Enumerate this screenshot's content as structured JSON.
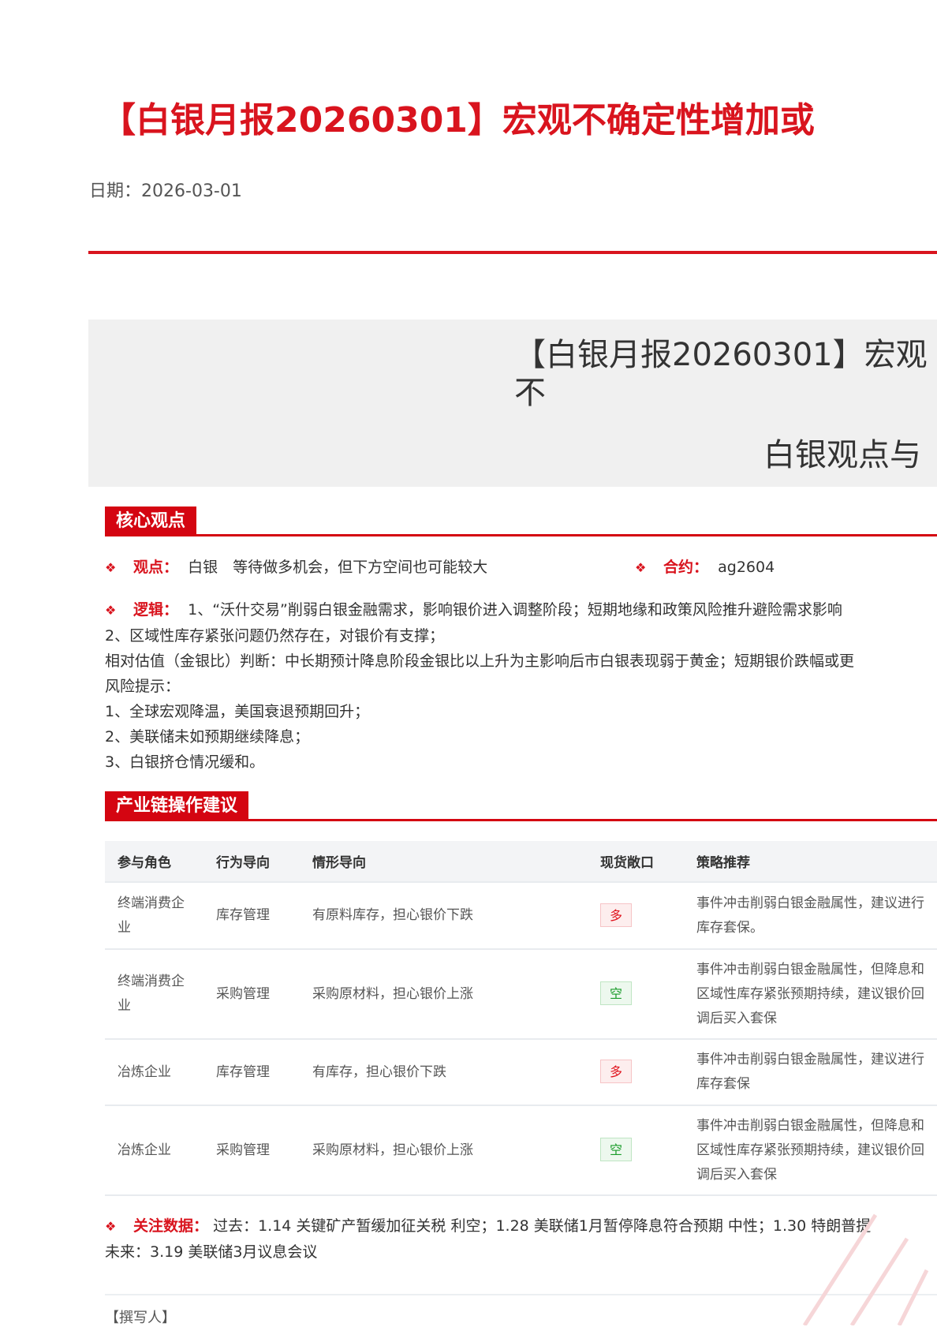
{
  "header": {
    "title": "【白银月报20260301】宏观不确定性增加或",
    "date_label": "日期：",
    "date": "2026-03-01"
  },
  "banner": {
    "title": "【白银月报20260301】宏观不",
    "subtitle": "白银观点与"
  },
  "core": {
    "heading": "核心观点",
    "view_label": "观点：",
    "view_text": "白银　等待做多机会，但下方空间也可能较大",
    "contract_label": "合约：",
    "contract_value": "ag2604",
    "logic_label": "逻辑：",
    "logic_lines": [
      "1、“沃什交易”削弱白银金融需求，影响银价进入调整阶段；短期地缘和政策风险推升避险需求影响",
      "2、区域性库存紧张问题仍然存在，对银价有支撑；",
      "相对估值（金银比）判断：中长期预计降息阶段金银比以上升为主影响后市白银表现弱于黄金；短期银价跌幅或更",
      "风险提示：",
      "1、全球宏观降温，美国衰退预期回升；",
      "2、美联储未如预期继续降息；",
      "3、白银挤仓情况缓和。"
    ]
  },
  "chain": {
    "heading": "产业链操作建议",
    "columns": [
      "参与角色",
      "行为导向",
      "情形导向",
      "现货敞口",
      "策略推荐"
    ],
    "rows": [
      {
        "role": "终端消费企业",
        "action": "库存管理",
        "scenario": "有原料库存，担心银价下跌",
        "exposure": "多",
        "exposure_type": "long",
        "strategy": "事件冲击削弱白银金融属性，建议进行库存套保。"
      },
      {
        "role": "终端消费企业",
        "action": "采购管理",
        "scenario": "采购原材料，担心银价上涨",
        "exposure": "空",
        "exposure_type": "short",
        "strategy": "事件冲击削弱白银金融属性，但降息和区域性库存紧张预期持续，建议银价回调后买入套保"
      },
      {
        "role": "冶炼企业",
        "action": "库存管理",
        "scenario": "有库存，担心银价下跌",
        "exposure": "多",
        "exposure_type": "long",
        "strategy": "事件冲击削弱白银金融属性，建议进行库存套保"
      },
      {
        "role": "冶炼企业",
        "action": "采购管理",
        "scenario": "采购原材料，担心银价上涨",
        "exposure": "空",
        "exposure_type": "short",
        "strategy": "事件冲击削弱白银金融属性，但降息和区域性库存紧张预期持续，建议银价回调后买入套保"
      }
    ]
  },
  "watch": {
    "label": "关注数据：",
    "past": "过去：1.14 关键矿产暂缓加征关税 利空；1.28 美联储1月暂停降息符合预期 中性；1.30 特朗普提",
    "future": "未来：3.19 美联储3月议息会议"
  },
  "author_label": "【撰写人】",
  "colors": {
    "accent": "#d9141e",
    "long": "#e0141e",
    "short": "#1a9c2a"
  }
}
